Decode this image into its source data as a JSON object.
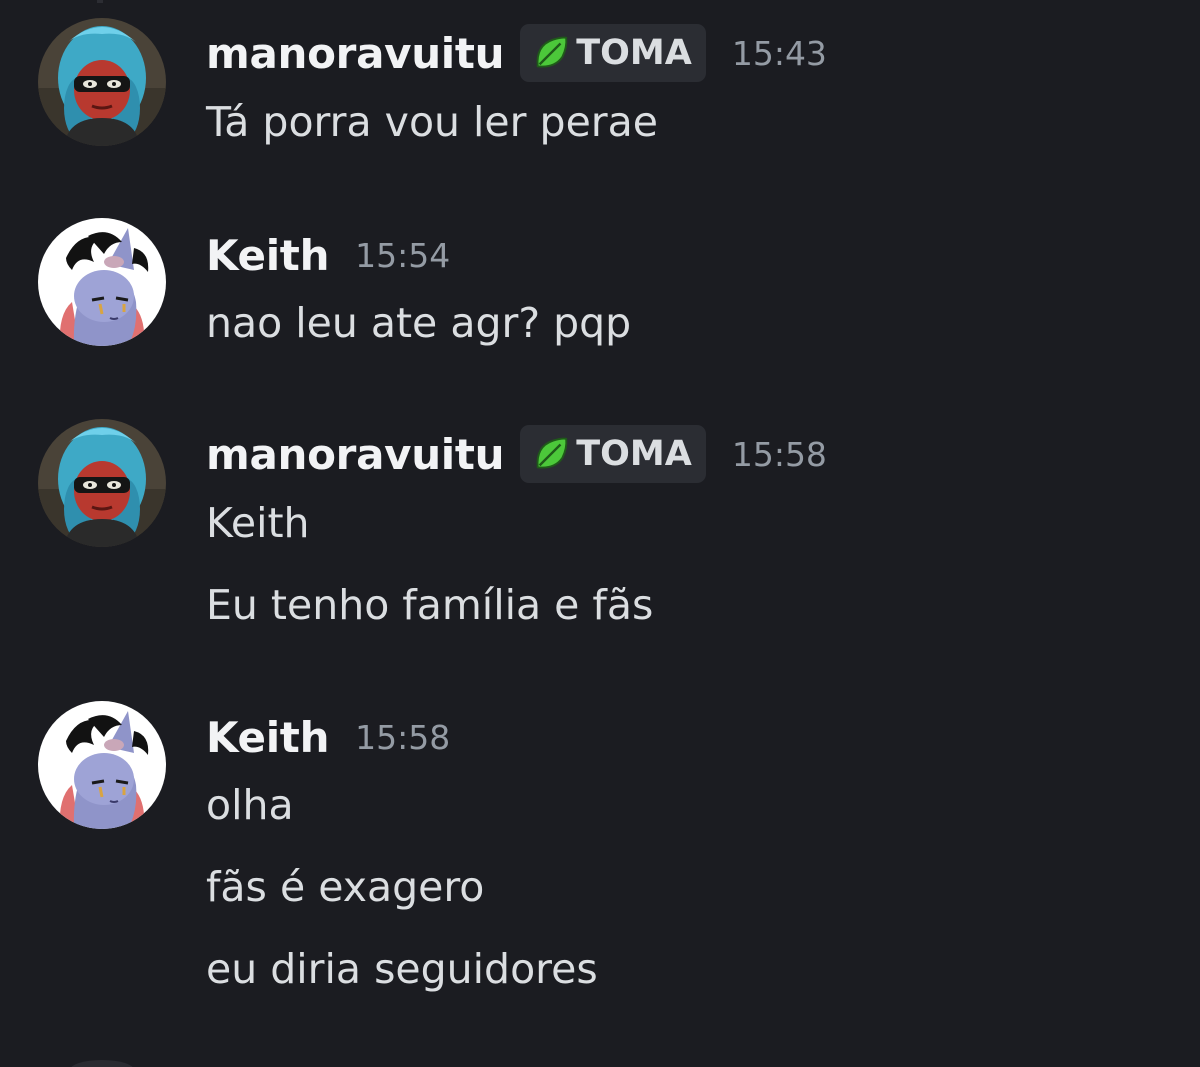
{
  "messages": [
    {
      "username": "manoravuitu",
      "role": "TOMA",
      "time": "15:43",
      "lines": [
        "Tá porra vou ler perae"
      ]
    },
    {
      "username": "Keith",
      "time": "15:54",
      "lines": [
        "nao leu ate agr? pqp"
      ]
    },
    {
      "username": "manoravuitu",
      "role": "TOMA",
      "time": "15:58",
      "lines": [
        "Keith",
        "Eu tenho família e fãs"
      ]
    },
    {
      "username": "Keith",
      "time": "15:58",
      "lines": [
        "olha",
        "fãs é exagero",
        "eu diria seguidores"
      ]
    }
  ],
  "icons": {
    "role": "leaf-icon",
    "avatar_manoravuitu": "avatar-blue-hair-masked-character",
    "avatar_keith": "avatar-purple-pony-character"
  },
  "colors": {
    "background": "#1b1c21",
    "username": "#f2f3f5",
    "message_text": "#dbdee1",
    "timestamp": "#949ba4",
    "role_tag_bg": "#2b2d33",
    "leaf_green": "#4cc83a"
  }
}
